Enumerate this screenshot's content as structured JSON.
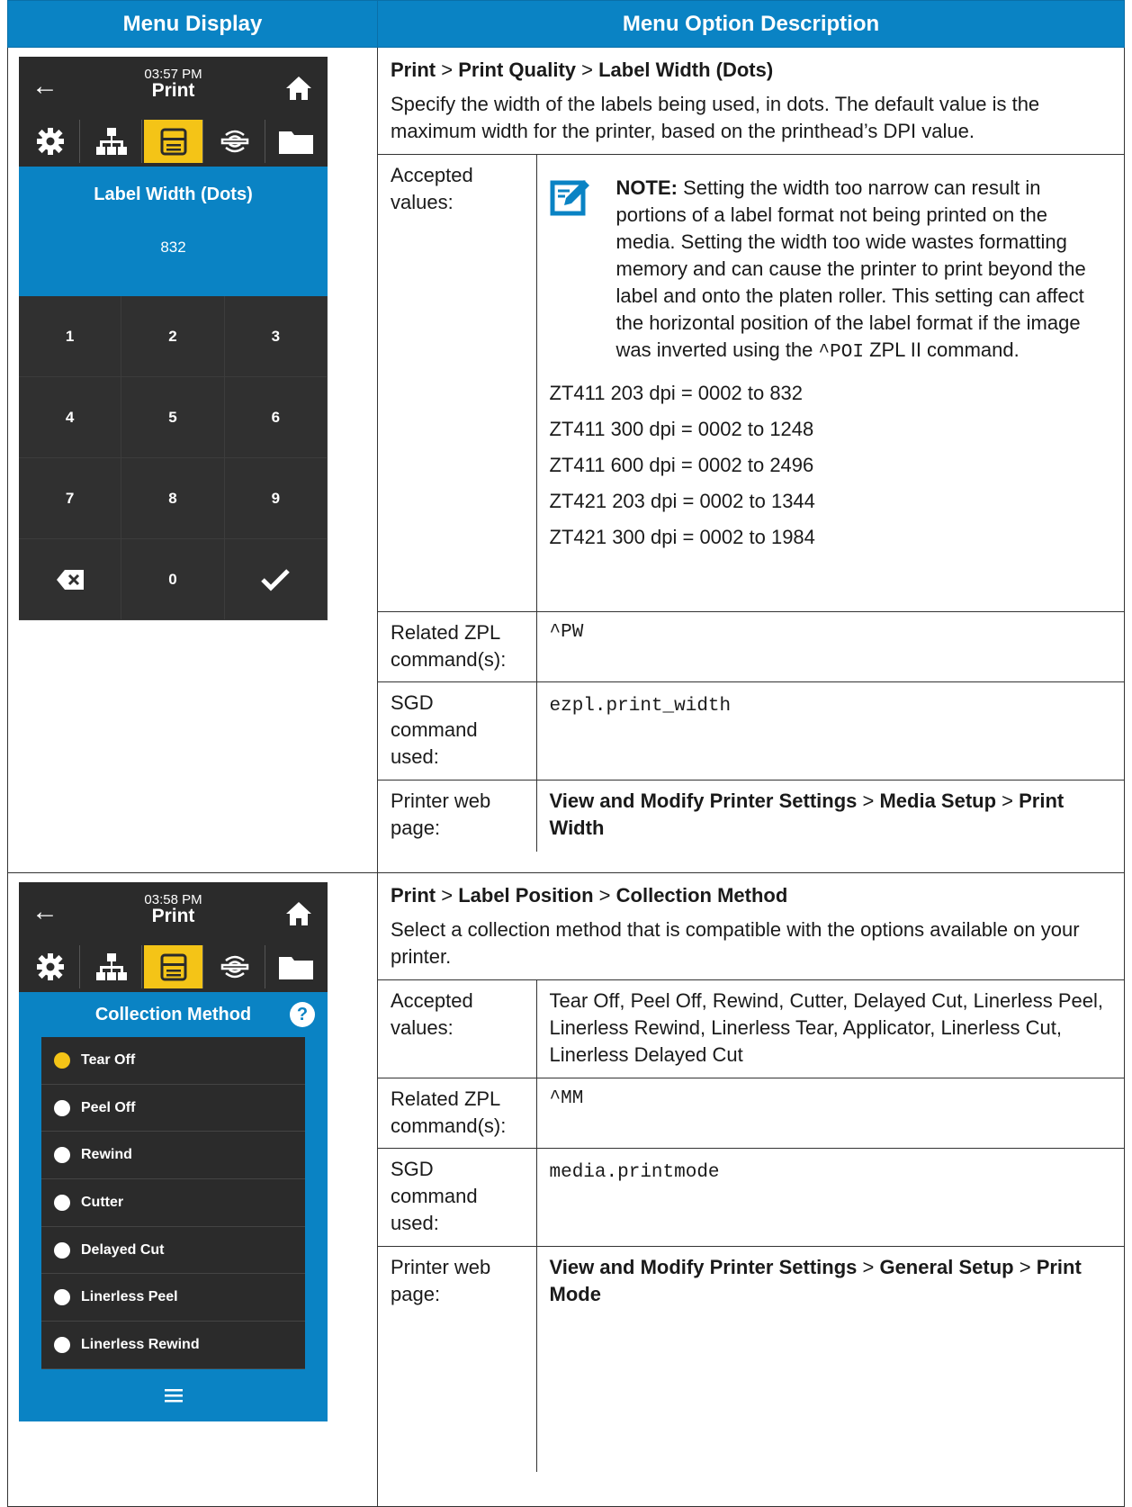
{
  "header": {
    "col_display": "Menu Display",
    "col_description": "Menu Option Description"
  },
  "colors": {
    "header_blue": "#0a83c4",
    "active_tab": "#f4c417",
    "device_dark": "#2b2b2b"
  },
  "row1": {
    "device": {
      "time": "03:57 PM",
      "title": "Print",
      "field_title": "Label Width (Dots)",
      "value": "832",
      "keys": [
        "1",
        "2",
        "3",
        "4",
        "5",
        "6",
        "7",
        "8",
        "9",
        "",
        "0",
        ""
      ],
      "tabs": [
        "gear-icon",
        "network-icon",
        "printer-icon",
        "rfid-icon",
        "folder-icon"
      ]
    },
    "path": {
      "p1": "Print",
      "sep1": " > ",
      "p2": "Print Quality",
      "sep2": " > ",
      "p3": "Label Width (Dots)"
    },
    "description": "Specify the width of the labels being used, in dots. The default value is the maximum width for the printer, based on the printhead’s DPI value.",
    "accepted_label": "Accepted values:",
    "note_label": "NOTE:",
    "note_text_1": " Setting the width too narrow can result in portions of a label format not being printed on the media. Setting the width too wide wastes formatting memory and can cause the printer to print beyond the label and onto the platen roller. This setting can affect the horizontal position of the label format if the image was inverted using the ",
    "note_code": "^POI",
    "note_text_2": " ZPL II command.",
    "dpi_values": [
      "ZT411 203 dpi = 0002 to 832",
      "ZT411 300 dpi = 0002 to 1248",
      "ZT411 600 dpi = 0002 to 2496",
      "ZT421 203 dpi = 0002 to 1344",
      "ZT421 300 dpi = 0002 to 1984"
    ],
    "zpl_label": "Related ZPL command(s):",
    "zpl_value": "^PW",
    "sgd_label": "SGD command used:",
    "sgd_value": "ezpl.print_width",
    "web_label": "Printer web page:",
    "web_p1": "View and Modify Printer Settings",
    "web_sep1": " > ",
    "web_p2": "Media Setup",
    "web_sep2": " > ",
    "web_p3": "Print Width"
  },
  "row2": {
    "device": {
      "time": "03:58 PM",
      "title": "Print",
      "field_title": "Collection Method",
      "help": "?",
      "options": [
        "Tear Off",
        "Peel Off",
        "Rewind",
        "Cutter",
        "Delayed Cut",
        "Linerless Peel",
        "Linerless Rewind"
      ],
      "selected_index": 0
    },
    "path": {
      "p1": "Print",
      "sep1": " > ",
      "p2": "Label Position",
      "sep2": " > ",
      "p3": "Collection Method"
    },
    "description": "Select a collection method that is compatible with the options available on your printer.",
    "accepted_label": "Accepted values:",
    "accepted_value": "Tear Off, Peel Off, Rewind, Cutter, Delayed Cut, Linerless Peel, Linerless Rewind, Linerless Tear, Applicator, Linerless Cut, Linerless Delayed Cut",
    "zpl_label": "Related ZPL command(s):",
    "zpl_value": "^MM",
    "sgd_label": "SGD command used:",
    "sgd_value": "media.printmode",
    "web_label": "Printer web page:",
    "web_p1": "View and Modify Printer Settings",
    "web_sep1": " > ",
    "web_p2": "General Setup",
    "web_sep2": " > ",
    "web_p3": "Print Mode"
  }
}
